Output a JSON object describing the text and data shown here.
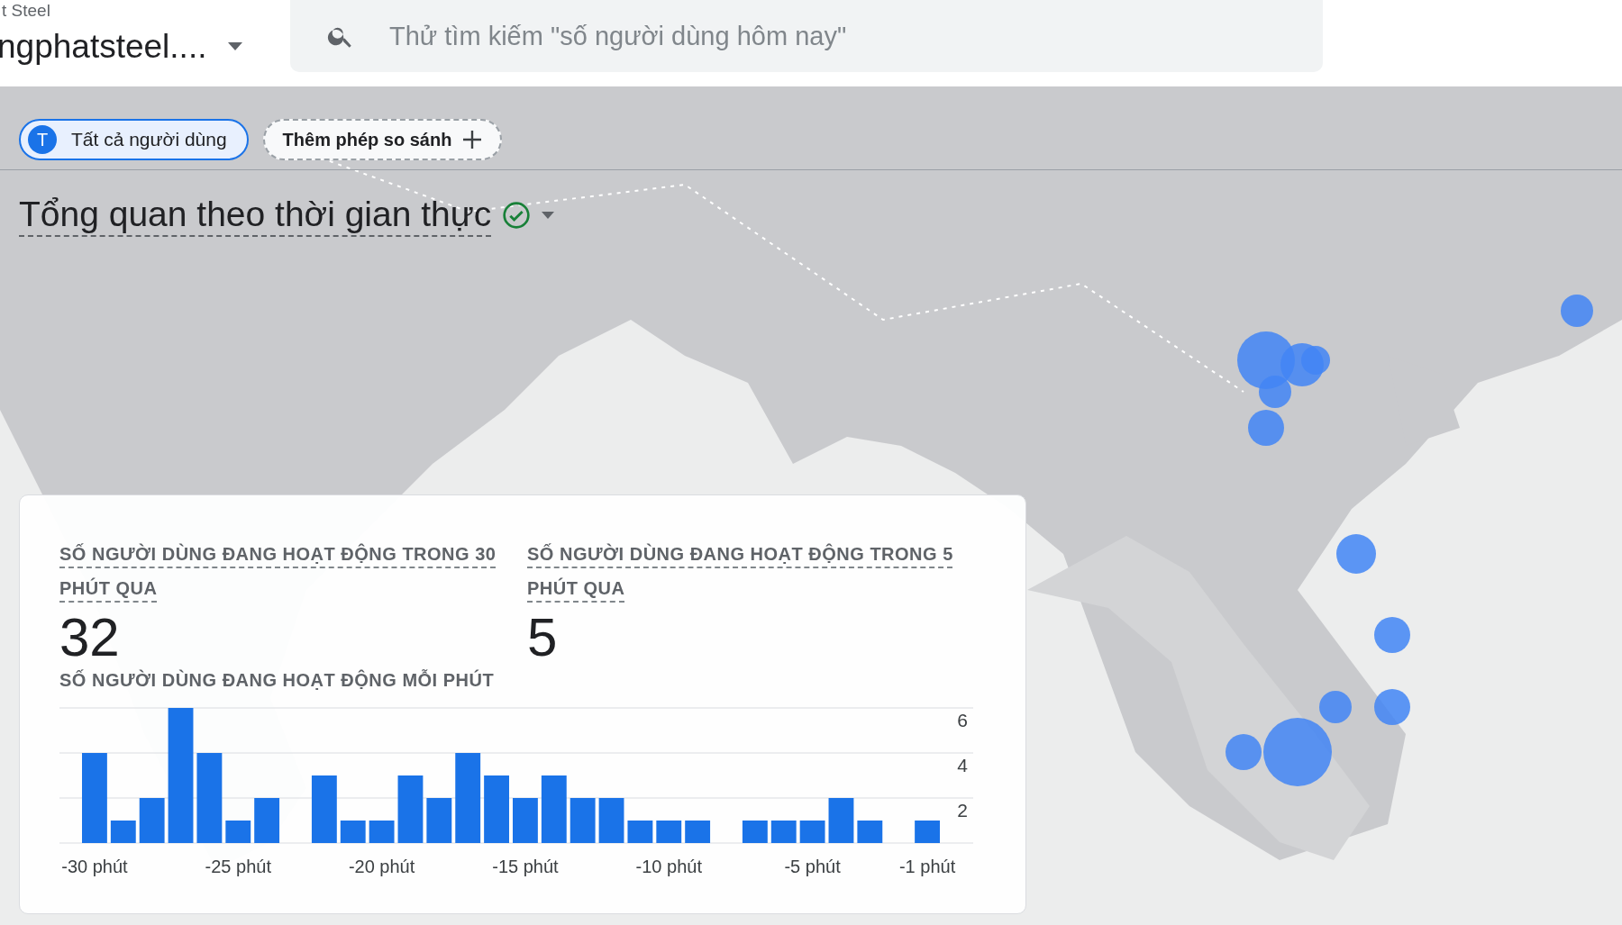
{
  "header": {
    "account": "t Steel",
    "property": "ngphatsteel....",
    "search": {
      "placeholder": "Thử tìm kiếm \"số người dùng hôm nay\""
    }
  },
  "comparisons": [
    {
      "kind": "segment",
      "badge": "T",
      "label": "Tất cả người dùng"
    },
    {
      "kind": "add",
      "label": "Thêm phép so sánh"
    }
  ],
  "title": "Tổng quan theo thời gian thực",
  "card": {
    "metrics": [
      {
        "label": "SỐ NGƯỜI DÙNG ĐANG HOẠT ĐỘNG TRONG 30 PHÚT QUA",
        "value": "32"
      },
      {
        "label": "SỐ NGƯỜI DÙNG ĐANG HOẠT ĐỘNG TRONG 5 PHÚT QUA",
        "value": "5"
      }
    ],
    "chart_title": "SỐ NGƯỜI DÙNG ĐANG HOẠT ĐỘNG MỖI PHÚT",
    "chart_data": {
      "type": "bar",
      "x": [
        -30,
        -29,
        -28,
        -27,
        -26,
        -25,
        -24,
        -23,
        -22,
        -21,
        -20,
        -19,
        -18,
        -17,
        -16,
        -15,
        -14,
        -13,
        -12,
        -11,
        -10,
        -9,
        -8,
        -7,
        -6,
        -5,
        -4,
        -3,
        -2,
        -1
      ],
      "series": [
        {
          "color": "#1a73e8",
          "values": [
            4,
            1,
            2,
            6,
            4,
            1,
            2,
            0,
            3,
            1,
            1,
            3,
            2,
            4,
            3,
            2,
            3,
            2,
            2,
            1,
            1,
            1,
            0,
            1,
            1,
            1,
            2,
            1,
            0,
            1
          ]
        }
      ],
      "xlim": [
        -30.5,
        -0.5
      ],
      "ylim": [
        0,
        6
      ],
      "yticks": [
        2,
        4,
        6
      ],
      "xticks": [
        {
          "value": -30,
          "label": "-30 phút"
        },
        {
          "value": -25,
          "label": "-25 phút"
        },
        {
          "value": -20,
          "label": "-20 phút"
        },
        {
          "value": -15,
          "label": "-15 phút"
        },
        {
          "value": -10,
          "label": "-10 phút"
        },
        {
          "value": -5,
          "label": "-5 phút"
        },
        {
          "value": -1,
          "label": "-1 phút"
        }
      ]
    }
  }
}
